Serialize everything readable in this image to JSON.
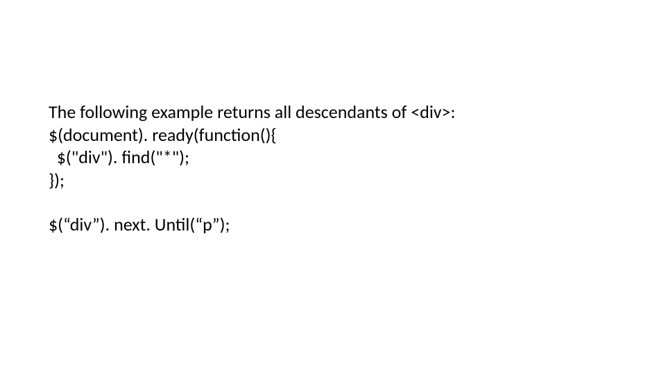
{
  "slide": {
    "intro": "The following example returns all descendants of <div>:",
    "code": {
      "line1": "$(document). ready(function(){",
      "line2": "  $(\"div\"). find(\"*\");",
      "line3": "});"
    },
    "extra": "$(“div”). next. Until(“p”);"
  }
}
